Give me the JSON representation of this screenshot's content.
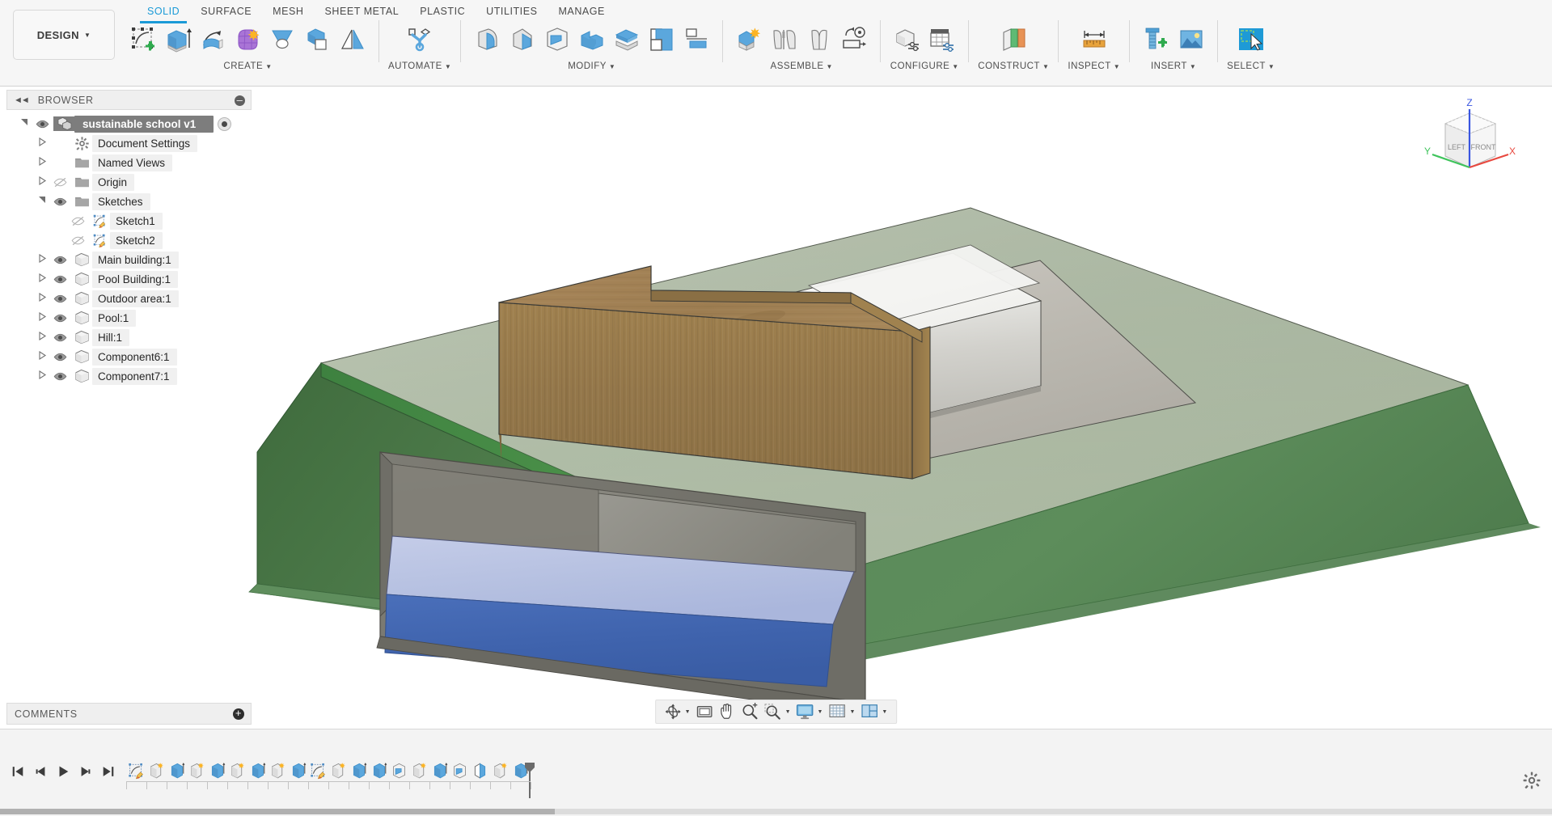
{
  "app": {
    "workspace_label": "DESIGN",
    "document_title": "sustainable school v1"
  },
  "ribbon": {
    "tabs": [
      {
        "label": "SOLID",
        "active": true
      },
      {
        "label": "SURFACE",
        "active": false
      },
      {
        "label": "MESH",
        "active": false
      },
      {
        "label": "SHEET METAL",
        "active": false
      },
      {
        "label": "PLASTIC",
        "active": false
      },
      {
        "label": "UTILITIES",
        "active": false
      },
      {
        "label": "MANAGE",
        "active": false
      }
    ],
    "groups": [
      {
        "label": "CREATE",
        "has_caret": true,
        "tools": [
          {
            "name": "create-sketch-icon",
            "title": "Create Sketch"
          },
          {
            "name": "extrude-icon",
            "title": "Extrude"
          },
          {
            "name": "revolve-icon",
            "title": "Revolve"
          },
          {
            "name": "form-icon",
            "title": "Create Form"
          },
          {
            "name": "loft-icon",
            "title": "Loft"
          },
          {
            "name": "combine-icon",
            "title": "Combine"
          },
          {
            "name": "mirror-icon",
            "title": "Mirror"
          }
        ]
      },
      {
        "label": "AUTOMATE",
        "has_caret": true,
        "tools": [
          {
            "name": "automate-icon",
            "title": "Automated Modeling"
          }
        ]
      },
      {
        "label": "MODIFY",
        "has_caret": true,
        "tools": [
          {
            "name": "fillet-icon",
            "title": "Fillet"
          },
          {
            "name": "chamfer-icon",
            "title": "Chamfer"
          },
          {
            "name": "shell-icon",
            "title": "Shell"
          },
          {
            "name": "press-pull-icon",
            "title": "Press Pull"
          },
          {
            "name": "offset-face-icon",
            "title": "Offset Face"
          },
          {
            "name": "split-body-icon",
            "title": "Split Body"
          },
          {
            "name": "align-icon",
            "title": "Align"
          }
        ]
      },
      {
        "label": "ASSEMBLE",
        "has_caret": true,
        "tools": [
          {
            "name": "new-component-icon",
            "title": "New Component"
          },
          {
            "name": "joint-icon",
            "title": "Joint"
          },
          {
            "name": "as-built-joint-icon",
            "title": "As-built Joint"
          },
          {
            "name": "motion-link-icon",
            "title": "Motion Link"
          }
        ]
      },
      {
        "label": "CONFIGURE",
        "has_caret": true,
        "tools": [
          {
            "name": "configure-design-icon",
            "title": "Configure Design"
          },
          {
            "name": "configuration-table-icon",
            "title": "Configuration Table"
          }
        ]
      },
      {
        "label": "CONSTRUCT",
        "has_caret": true,
        "tools": [
          {
            "name": "offset-plane-icon",
            "title": "Offset Plane"
          }
        ]
      },
      {
        "label": "INSPECT",
        "has_caret": true,
        "tools": [
          {
            "name": "measure-icon",
            "title": "Measure"
          }
        ]
      },
      {
        "label": "INSERT",
        "has_caret": true,
        "tools": [
          {
            "name": "insert-mcmaster-icon",
            "title": "Insert McMaster-Carr Component"
          },
          {
            "name": "insert-canvas-icon",
            "title": "Canvas"
          }
        ]
      },
      {
        "label": "SELECT",
        "has_caret": true,
        "tools": [
          {
            "name": "select-icon",
            "title": "Select"
          }
        ]
      }
    ]
  },
  "browser": {
    "title": "BROWSER",
    "collapse_icon": "chevron-double-left-icon",
    "options_icon": "browser-options-icon",
    "tree": [
      {
        "label": "sustainable school v1",
        "depth": 0,
        "arrow": "open",
        "eye": "visible",
        "icon": "document-icon",
        "root": true,
        "radio": true
      },
      {
        "label": "Document Settings",
        "depth": 1,
        "arrow": "closed",
        "eye": "none",
        "icon": "gear-icon"
      },
      {
        "label": "Named Views",
        "depth": 1,
        "arrow": "closed",
        "eye": "none",
        "icon": "folder-icon"
      },
      {
        "label": "Origin",
        "depth": 1,
        "arrow": "closed",
        "eye": "hidden",
        "icon": "folder-icon"
      },
      {
        "label": "Sketches",
        "depth": 1,
        "arrow": "open",
        "eye": "visible",
        "icon": "folder-icon"
      },
      {
        "label": "Sketch1",
        "depth": 2,
        "arrow": "none",
        "eye": "hidden",
        "icon": "sketch-icon"
      },
      {
        "label": "Sketch2",
        "depth": 2,
        "arrow": "none",
        "eye": "hidden",
        "icon": "sketch-icon"
      },
      {
        "label": "Main building:1",
        "depth": 1,
        "arrow": "closed",
        "eye": "visible",
        "icon": "component-icon"
      },
      {
        "label": "Pool Building:1",
        "depth": 1,
        "arrow": "closed",
        "eye": "visible",
        "icon": "component-icon"
      },
      {
        "label": "Outdoor area:1",
        "depth": 1,
        "arrow": "closed",
        "eye": "visible",
        "icon": "component-icon"
      },
      {
        "label": "Pool:1",
        "depth": 1,
        "arrow": "closed",
        "eye": "visible",
        "icon": "component-icon"
      },
      {
        "label": "Hill:1",
        "depth": 1,
        "arrow": "closed",
        "eye": "visible",
        "icon": "component-icon"
      },
      {
        "label": "Component6:1",
        "depth": 1,
        "arrow": "closed",
        "eye": "visible",
        "icon": "component-icon"
      },
      {
        "label": "Component7:1",
        "depth": 1,
        "arrow": "closed",
        "eye": "visible",
        "icon": "component-icon"
      }
    ]
  },
  "comments": {
    "title": "COMMENTS",
    "add_icon": "plus-circle-icon"
  },
  "viewcube": {
    "face_left_label": "LEFT",
    "face_front_label": "FRONT",
    "axis_x_label": "X",
    "axis_y_label": "Y",
    "axis_z_label": "Z",
    "axis_x_color": "#e8493f",
    "axis_y_color": "#3fc45c",
    "axis_z_color": "#3a56e0"
  },
  "navbar": {
    "items": [
      {
        "name": "orbit-icon",
        "title": "Orbit",
        "caret": true
      },
      {
        "name": "look-at-icon",
        "title": "Look At",
        "caret": false
      },
      {
        "name": "pan-icon",
        "title": "Pan",
        "caret": false
      },
      {
        "name": "zoom-icon",
        "title": "Zoom",
        "caret": false
      },
      {
        "name": "fit-icon",
        "title": "Fit",
        "caret": true
      },
      {
        "name": "display-settings-icon",
        "title": "Display Settings",
        "caret": true
      },
      {
        "name": "grid-snaps-icon",
        "title": "Grid and Snaps",
        "caret": true
      },
      {
        "name": "viewports-icon",
        "title": "Viewports",
        "caret": true
      }
    ]
  },
  "timeline": {
    "playback": [
      {
        "name": "go-to-beginning-icon",
        "title": "Go to Beginning"
      },
      {
        "name": "step-back-icon",
        "title": "Step Back"
      },
      {
        "name": "play-icon",
        "title": "Play"
      },
      {
        "name": "step-forward-icon",
        "title": "Step Forward"
      },
      {
        "name": "go-to-end-icon",
        "title": "Go to End"
      }
    ],
    "features": [
      {
        "name": "sketch-icon",
        "title": "Sketch1"
      },
      {
        "name": "revolve-icon",
        "title": "Revolve"
      },
      {
        "name": "extrude-icon",
        "title": "Extrude"
      },
      {
        "name": "revolve-icon",
        "title": "Revolve"
      },
      {
        "name": "extrude-icon",
        "title": "Extrude"
      },
      {
        "name": "revolve-icon",
        "title": "Revolve"
      },
      {
        "name": "extrude-icon",
        "title": "Extrude"
      },
      {
        "name": "revolve-icon",
        "title": "Revolve"
      },
      {
        "name": "extrude-icon",
        "title": "Extrude"
      },
      {
        "name": "sketch-icon",
        "title": "Sketch2"
      },
      {
        "name": "revolve-icon",
        "title": "Revolve"
      },
      {
        "name": "extrude-icon",
        "title": "Extrude"
      },
      {
        "name": "extrude-icon",
        "title": "Extrude"
      },
      {
        "name": "shell-icon",
        "title": "Shell"
      },
      {
        "name": "revolve-icon",
        "title": "Revolve"
      },
      {
        "name": "extrude-icon",
        "title": "Extrude"
      },
      {
        "name": "shell-icon",
        "title": "Shell"
      },
      {
        "name": "split-face-icon",
        "title": "Split Face"
      },
      {
        "name": "revolve-icon",
        "title": "Revolve"
      },
      {
        "name": "extrude-icon",
        "title": "Extrude"
      }
    ],
    "settings_icon": "gear-icon",
    "marker_icon": "timeline-marker-icon"
  },
  "model": {
    "name": "sustainable school",
    "parts": [
      {
        "name": "Main building",
        "material": "wood",
        "color": "#9c7c50"
      },
      {
        "name": "Pool Building",
        "material": "plastic-white",
        "color": "#d8d6d0"
      },
      {
        "name": "Outdoor area",
        "material": "concrete",
        "color": "#bdbab2"
      },
      {
        "name": "Pool water",
        "material": "water",
        "color": "#3f63ad"
      },
      {
        "name": "Pool surface",
        "material": "water-top",
        "color": "#bcc6e4"
      },
      {
        "name": "Pool walls",
        "material": "concrete-grey",
        "color": "#8a8a83"
      },
      {
        "name": "Hill slope",
        "material": "grass",
        "color": "#5c8a5a"
      },
      {
        "name": "Hill top",
        "material": "grass-light",
        "color": "#b5c1ae"
      }
    ]
  }
}
